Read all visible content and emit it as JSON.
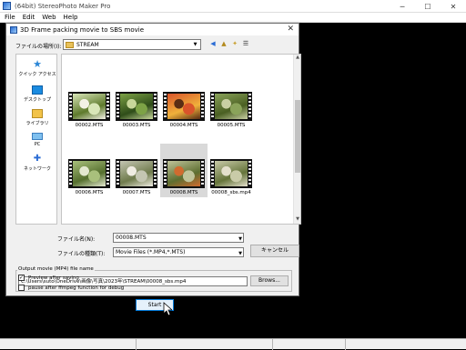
{
  "app": {
    "title": "(64bit) StereoPhoto Maker Pro",
    "menu": [
      "File",
      "Edit",
      "Web",
      "Help"
    ],
    "window_controls": {
      "minimize": "─",
      "maximize": "☐",
      "close": "✕"
    }
  },
  "dialog": {
    "title": "3D Frame packing movie to SBS movie",
    "close": "✕",
    "look_in_label": "ファイルの場所(I):",
    "look_in_value": "STREAM",
    "places": [
      {
        "label": "クイック アクセス",
        "glyph": "★"
      },
      {
        "label": "デスクトップ",
        "glyph": ""
      },
      {
        "label": "ライブラリ",
        "glyph": ""
      },
      {
        "label": "PC",
        "glyph": ""
      },
      {
        "label": "ネットワーク",
        "glyph": "✚"
      }
    ],
    "files": [
      {
        "name": "00002.MTS",
        "colors": [
          "#d9e6b8",
          "#5e7a2c",
          "#f3f1e6"
        ]
      },
      {
        "name": "00003.MTS",
        "colors": [
          "#7da246",
          "#2f4d19",
          "#c8d79a"
        ]
      },
      {
        "name": "00004.MTS",
        "colors": [
          "#d9542a",
          "#f0b13b",
          "#5a2d14"
        ]
      },
      {
        "name": "00005.MTS",
        "colors": [
          "#8aa35a",
          "#4a5f22",
          "#c9cfa3"
        ]
      },
      {
        "name": "00006.MTS",
        "colors": [
          "#a9c07c",
          "#556f2e",
          "#e3e8cf"
        ]
      },
      {
        "name": "00007.MTS",
        "colors": [
          "#c4c6b2",
          "#6f7b4c",
          "#efece2"
        ]
      },
      {
        "name": "00008.MTS",
        "colors": [
          "#c0c49a",
          "#5d6e30",
          "#d06b2f"
        ]
      },
      {
        "name": "00008_sbs.mp4",
        "colors": [
          "#c9cba8",
          "#65743a",
          "#e4e0cc"
        ]
      }
    ],
    "filename_label": "ファイル名(N):",
    "filename_value": "00008.MTS",
    "filetype_label": "ファイルの種類(T):",
    "filetype_value": "Movie Files (*.MP4,*.MTS)",
    "cancel_label": "キャンセル",
    "output_group_title": "Output movie (MP4) file name",
    "output_path": "C:\\Users\\suto\\OneDrive\\画像\\写真\\2023年\\STREAM\\00008_sbs.mp4",
    "browse_label": "Brows...",
    "preview_label": "Preview after saving",
    "preview_checked": true,
    "pause_label": "pause after ffmpeg function for debug",
    "pause_checked": false,
    "start_label": "Start"
  }
}
